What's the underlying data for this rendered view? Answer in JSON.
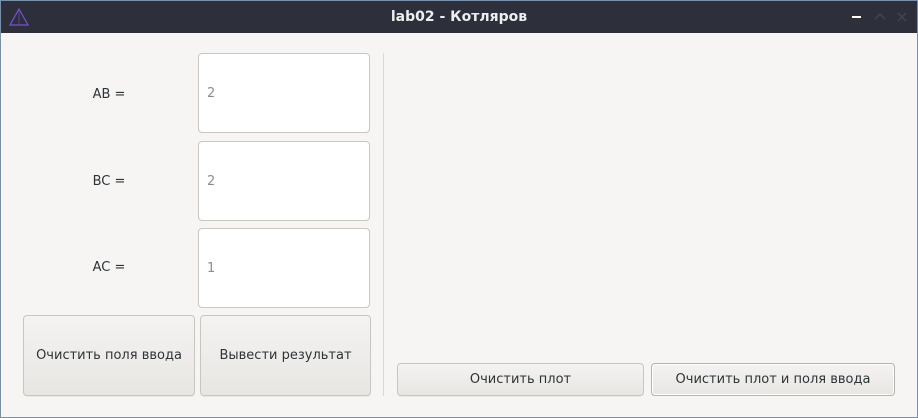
{
  "window": {
    "title": "lab02 - Котляров"
  },
  "form": {
    "fields": [
      {
        "label": "AB =",
        "placeholder": "2"
      },
      {
        "label": "BC =",
        "placeholder": "2"
      },
      {
        "label": "AC =",
        "placeholder": "1"
      }
    ],
    "buttons": {
      "clear_inputs": "Очистить поля ввода",
      "show_result": "Вывести результат"
    }
  },
  "plot": {
    "buttons": {
      "clear_plot": "Очистить плот",
      "clear_plot_and_inputs": "Очистить плот и поля ввода"
    }
  },
  "icons": {
    "app": "triangle-icon",
    "minimize": "minimize-icon",
    "maximize": "maximize-icon",
    "close": "close-icon"
  },
  "colors": {
    "titlebar": "#2d2f3a",
    "window_bg": "#f6f5f4",
    "icon_accent": "#7a4fd6"
  }
}
